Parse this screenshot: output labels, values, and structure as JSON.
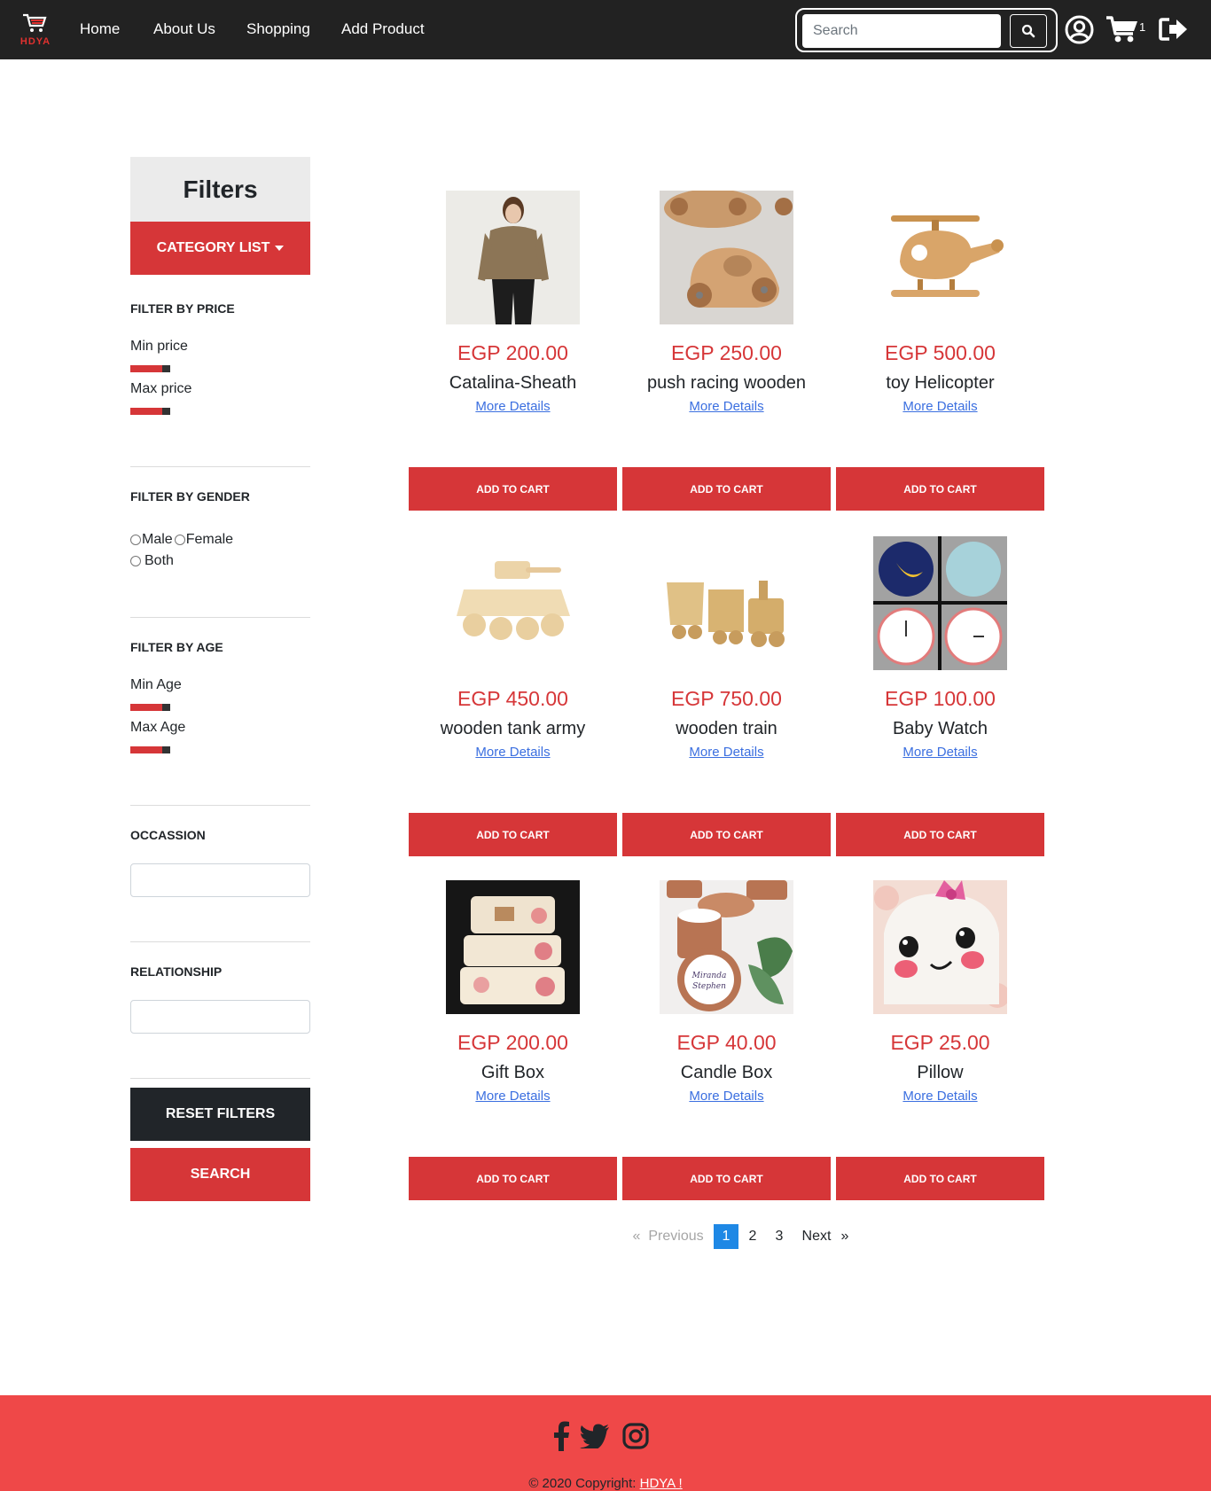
{
  "nav": {
    "logo_text": "HDYA",
    "links": [
      "Home",
      "About Us",
      "Shopping",
      "Add Product"
    ],
    "search_placeholder": "Search",
    "cart_count": "1",
    "icons": [
      "search-icon",
      "user-circle-icon",
      "cart-icon",
      "sign-out-icon"
    ]
  },
  "sidebar": {
    "title": "Filters",
    "category_button": "CATEGORY LIST",
    "price": {
      "title": "FILTER BY PRICE",
      "min_label": "Min price",
      "max_label": "Max price"
    },
    "gender": {
      "title": "FILTER BY GENDER",
      "options": [
        "Male",
        "Female",
        "Both"
      ]
    },
    "age": {
      "title": "FILTER BY AGE",
      "min_label": "Min Age",
      "max_label": "Max Age"
    },
    "occasion": {
      "title": "OCCASSION",
      "value": ""
    },
    "relationship": {
      "title": "RELATIONSHIP",
      "value": ""
    },
    "reset_button": "RESET FILTERS",
    "search_button": "SEARCH"
  },
  "products": [
    {
      "price": "EGP 200.00",
      "name": "Catalina-Sheath",
      "details": "More Details",
      "add": "ADD TO CART",
      "image": "woman-shirt"
    },
    {
      "price": "EGP 250.00",
      "name": "push racing wooden",
      "details": "More Details",
      "add": "ADD TO CART",
      "image": "wooden-car"
    },
    {
      "price": "EGP 500.00",
      "name": "toy Helicopter",
      "details": "More Details",
      "add": "ADD TO CART",
      "image": "wooden-helicopter"
    },
    {
      "price": "EGP 450.00",
      "name": "wooden tank army",
      "details": "More Details",
      "add": "ADD TO CART",
      "image": "wooden-tank"
    },
    {
      "price": "EGP 750.00",
      "name": "wooden train",
      "details": "More Details",
      "add": "ADD TO CART",
      "image": "wooden-train"
    },
    {
      "price": "EGP 100.00",
      "name": "Baby Watch",
      "details": "More Details",
      "add": "ADD TO CART",
      "image": "baby-clocks"
    },
    {
      "price": "EGP 200.00",
      "name": "Gift Box",
      "details": "More Details",
      "add": "ADD TO CART",
      "image": "floral-gift-boxes"
    },
    {
      "price": "EGP 40.00",
      "name": "Candle Box",
      "details": "More Details",
      "add": "ADD TO CART",
      "image": "copper-candles"
    },
    {
      "price": "EGP 25.00",
      "name": "Pillow",
      "details": "More Details",
      "add": "ADD TO CART",
      "image": "cute-pillow"
    }
  ],
  "pagination": {
    "prev_arrow": "«",
    "prev": "Previous",
    "pages": [
      "1",
      "2",
      "3"
    ],
    "current": "1",
    "next": "Next",
    "next_arrow": "»"
  },
  "footer": {
    "social_icons": [
      "facebook-icon",
      "twitter-icon",
      "instagram-icon"
    ],
    "copyright": "© 2020 Copyright:",
    "brand_link": "HDYA !"
  },
  "colors": {
    "accent": "#d63638",
    "nav_bg": "#222222",
    "footer_bg": "#ef4848",
    "active_page": "#1e88e5"
  }
}
